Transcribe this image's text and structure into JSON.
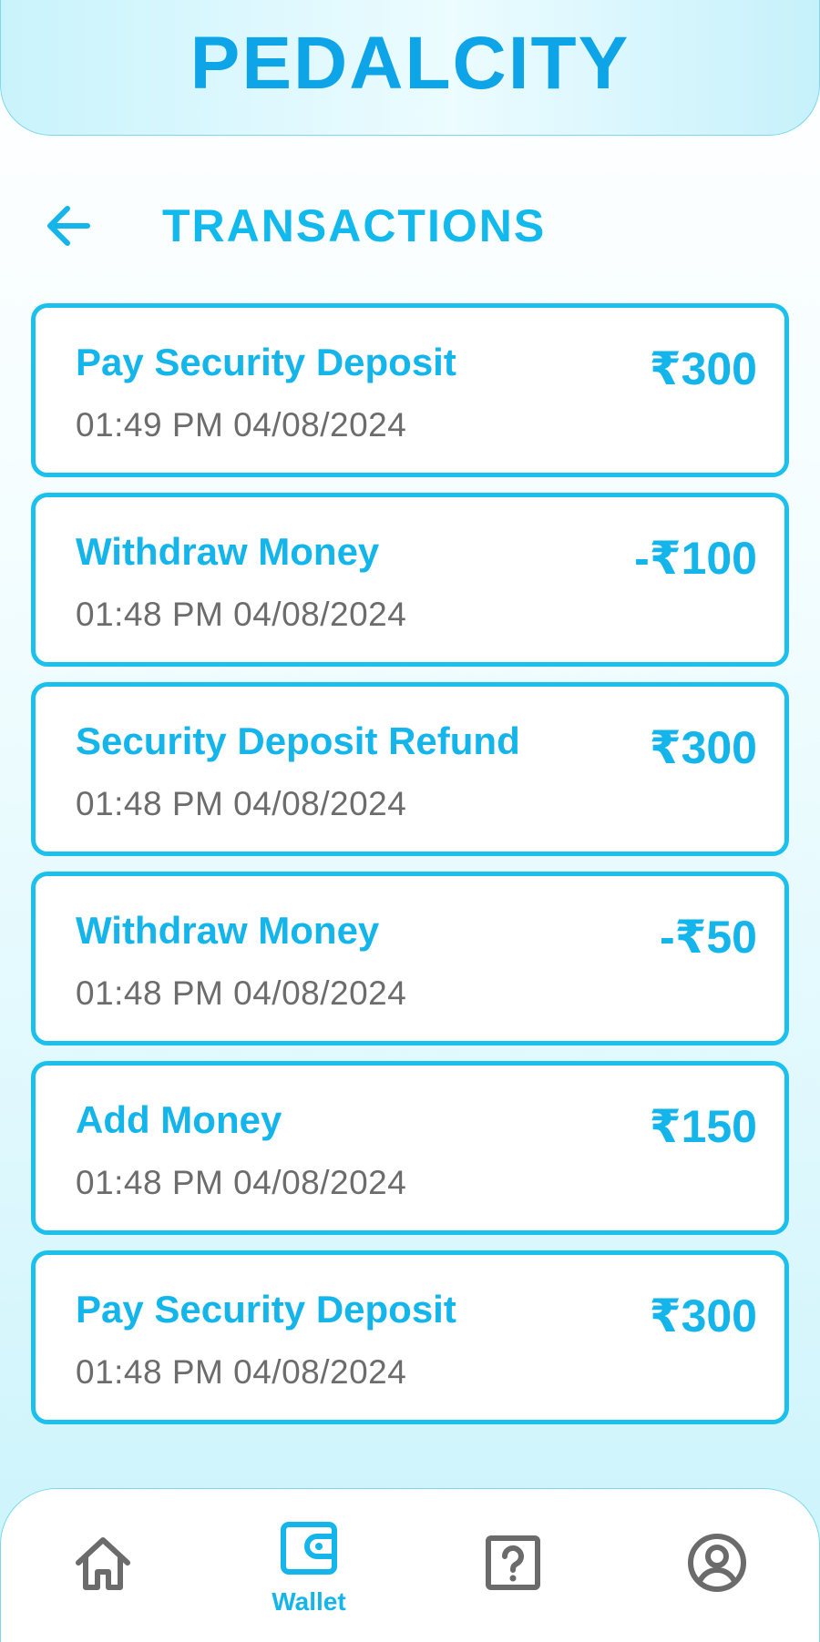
{
  "app": {
    "title": "PEDALCITY"
  },
  "page": {
    "title": "TRANSACTIONS",
    "back_icon": "arrow-left-icon"
  },
  "transactions": [
    {
      "title": "Pay Security Deposit",
      "time": "01:49 PM 04/08/2024",
      "amount": "₹300"
    },
    {
      "title": "Withdraw Money",
      "time": "01:48 PM 04/08/2024",
      "amount": "-₹100"
    },
    {
      "title": "Security Deposit Refund",
      "time": "01:48 PM 04/08/2024",
      "amount": "₹300"
    },
    {
      "title": "Withdraw Money",
      "time": "01:48 PM 04/08/2024",
      "amount": "-₹50"
    },
    {
      "title": "Add Money",
      "time": "01:48 PM 04/08/2024",
      "amount": "₹150"
    },
    {
      "title": "Pay Security Deposit",
      "time": "01:48 PM 04/08/2024",
      "amount": "₹300"
    }
  ],
  "nav": {
    "items": [
      {
        "icon": "home-icon",
        "label": "",
        "active": false
      },
      {
        "icon": "wallet-icon",
        "label": "Wallet",
        "active": true
      },
      {
        "icon": "help-icon",
        "label": "",
        "active": false
      },
      {
        "icon": "profile-icon",
        "label": "",
        "active": false
      }
    ]
  },
  "colors": {
    "accent": "#14b5ea",
    "title": "#0ea5e8",
    "card_border": "#1cc0ec",
    "secondary_text": "#6c6c6c",
    "inactive_icon": "#6b6b6b"
  }
}
